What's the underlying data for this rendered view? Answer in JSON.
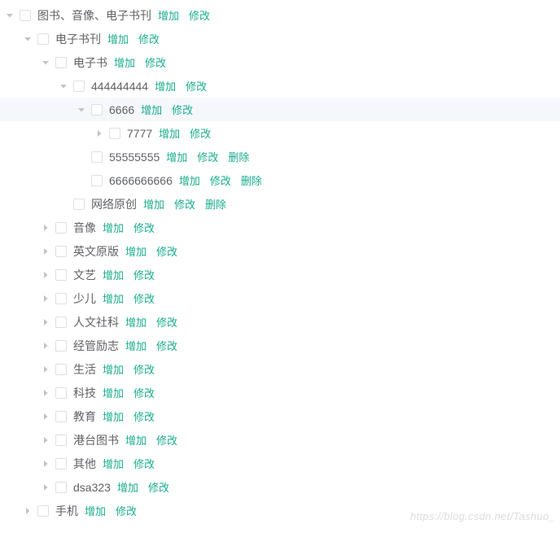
{
  "actions": {
    "add": "增加",
    "edit": "修改",
    "delete": "删除"
  },
  "watermark": "https://blog.csdn.net/Tashuo_",
  "tree": [
    {
      "id": "n0",
      "label": "图书、音像、电子书刊",
      "expanded": true,
      "highlighted": false,
      "actions": [
        "add",
        "edit"
      ],
      "children": [
        {
          "id": "n1",
          "label": "电子书刊",
          "expanded": true,
          "highlighted": false,
          "actions": [
            "add",
            "edit"
          ],
          "children": [
            {
              "id": "n2",
              "label": "电子书",
              "expanded": true,
              "highlighted": false,
              "actions": [
                "add",
                "edit"
              ],
              "children": [
                {
                  "id": "n3",
                  "label": "444444444",
                  "expanded": true,
                  "highlighted": false,
                  "actions": [
                    "add",
                    "edit"
                  ],
                  "children": [
                    {
                      "id": "n4",
                      "label": "6666",
                      "expanded": true,
                      "highlighted": true,
                      "actions": [
                        "add",
                        "edit"
                      ],
                      "children": [
                        {
                          "id": "n5",
                          "label": "7777",
                          "expanded": false,
                          "highlighted": false,
                          "actions": [
                            "add",
                            "edit"
                          ],
                          "children": [
                            {
                              "id": "placeholder",
                              "label": "",
                              "actions": []
                            }
                          ]
                        }
                      ]
                    },
                    {
                      "id": "n6",
                      "label": "55555555",
                      "expanded": false,
                      "highlighted": false,
                      "actions": [
                        "add",
                        "edit",
                        "delete"
                      ]
                    },
                    {
                      "id": "n7",
                      "label": "6666666666",
                      "expanded": false,
                      "highlighted": false,
                      "actions": [
                        "add",
                        "edit",
                        "delete"
                      ]
                    }
                  ]
                },
                {
                  "id": "n8",
                  "label": "网络原创",
                  "expanded": false,
                  "highlighted": false,
                  "actions": [
                    "add",
                    "edit",
                    "delete"
                  ]
                }
              ]
            },
            {
              "id": "n9",
              "label": "音像",
              "expanded": false,
              "highlighted": false,
              "actions": [
                "add",
                "edit"
              ],
              "children": [
                {
                  "id": "p",
                  "label": "",
                  "actions": []
                }
              ]
            },
            {
              "id": "n10",
              "label": "英文原版",
              "expanded": false,
              "highlighted": false,
              "actions": [
                "add",
                "edit"
              ],
              "children": [
                {
                  "id": "p",
                  "label": "",
                  "actions": []
                }
              ]
            },
            {
              "id": "n11",
              "label": "文艺",
              "expanded": false,
              "highlighted": false,
              "actions": [
                "add",
                "edit"
              ],
              "children": [
                {
                  "id": "p",
                  "label": "",
                  "actions": []
                }
              ]
            },
            {
              "id": "n12",
              "label": "少儿",
              "expanded": false,
              "highlighted": false,
              "actions": [
                "add",
                "edit"
              ],
              "children": [
                {
                  "id": "p",
                  "label": "",
                  "actions": []
                }
              ]
            },
            {
              "id": "n13",
              "label": "人文社科",
              "expanded": false,
              "highlighted": false,
              "actions": [
                "add",
                "edit"
              ],
              "children": [
                {
                  "id": "p",
                  "label": "",
                  "actions": []
                }
              ]
            },
            {
              "id": "n14",
              "label": "经管励志",
              "expanded": false,
              "highlighted": false,
              "actions": [
                "add",
                "edit"
              ],
              "children": [
                {
                  "id": "p",
                  "label": "",
                  "actions": []
                }
              ]
            },
            {
              "id": "n15",
              "label": "生活",
              "expanded": false,
              "highlighted": false,
              "actions": [
                "add",
                "edit"
              ],
              "children": [
                {
                  "id": "p",
                  "label": "",
                  "actions": []
                }
              ]
            },
            {
              "id": "n16",
              "label": "科技",
              "expanded": false,
              "highlighted": false,
              "actions": [
                "add",
                "edit"
              ],
              "children": [
                {
                  "id": "p",
                  "label": "",
                  "actions": []
                }
              ]
            },
            {
              "id": "n17",
              "label": "教育",
              "expanded": false,
              "highlighted": false,
              "actions": [
                "add",
                "edit"
              ],
              "children": [
                {
                  "id": "p",
                  "label": "",
                  "actions": []
                }
              ]
            },
            {
              "id": "n18",
              "label": "港台图书",
              "expanded": false,
              "highlighted": false,
              "actions": [
                "add",
                "edit"
              ],
              "children": [
                {
                  "id": "p",
                  "label": "",
                  "actions": []
                }
              ]
            },
            {
              "id": "n19",
              "label": "其他",
              "expanded": false,
              "highlighted": false,
              "actions": [
                "add",
                "edit"
              ],
              "children": [
                {
                  "id": "p",
                  "label": "",
                  "actions": []
                }
              ]
            },
            {
              "id": "n20",
              "label": "dsa323",
              "expanded": false,
              "highlighted": false,
              "actions": [
                "add",
                "edit"
              ],
              "children": [
                {
                  "id": "p",
                  "label": "",
                  "actions": []
                }
              ]
            }
          ]
        },
        {
          "id": "n21",
          "label": "手机",
          "expanded": false,
          "highlighted": false,
          "actions": [
            "add",
            "edit"
          ],
          "children": [
            {
              "id": "p",
              "label": "",
              "actions": []
            }
          ]
        }
      ]
    }
  ]
}
